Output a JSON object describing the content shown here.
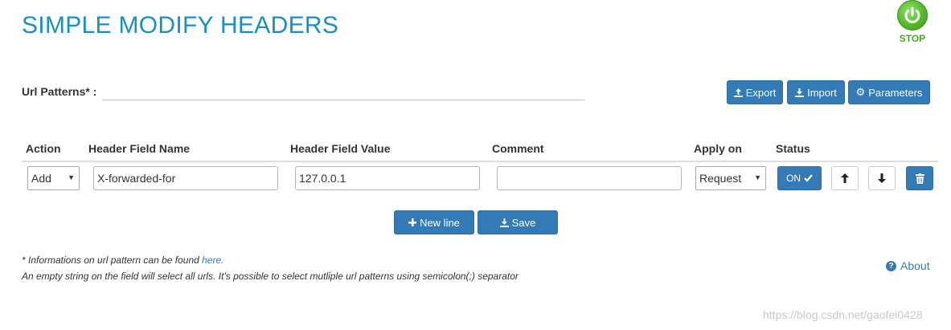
{
  "app": {
    "title": "SIMPLE MODIFY HEADERS"
  },
  "stop_button": {
    "label": "STOP",
    "icon": "power-icon"
  },
  "url_patterns": {
    "label": "Url Patterns* :",
    "value": ""
  },
  "toolbar": {
    "export_label": "Export",
    "import_label": "Import",
    "parameters_label": "Parameters"
  },
  "table": {
    "headers": [
      "Action",
      "Header Field Name",
      "Header Field Value",
      "Comment",
      "Apply on",
      "Status"
    ],
    "rows": [
      {
        "action": "Add",
        "header_field_name": "X-forwarded-for",
        "header_field_value": "127.0.0.1",
        "comment": "",
        "apply_on": "Request",
        "status": "ON"
      }
    ]
  },
  "actions": {
    "new_line_label": "New line",
    "save_label": "Save"
  },
  "notes": {
    "line1_prefix": "* Informations on url pattern can be found ",
    "line1_link": "here.",
    "line2": "An empty string on the field will select all urls. It's possible to select mutliple url patterns using semicolon(;) separator"
  },
  "about": {
    "label": "About"
  },
  "watermark": "https://blog.csdn.net/gaofei0428",
  "colors": {
    "title": "#1a8fc0",
    "primary": "#337ab7",
    "stop_green": "#55b82b"
  }
}
